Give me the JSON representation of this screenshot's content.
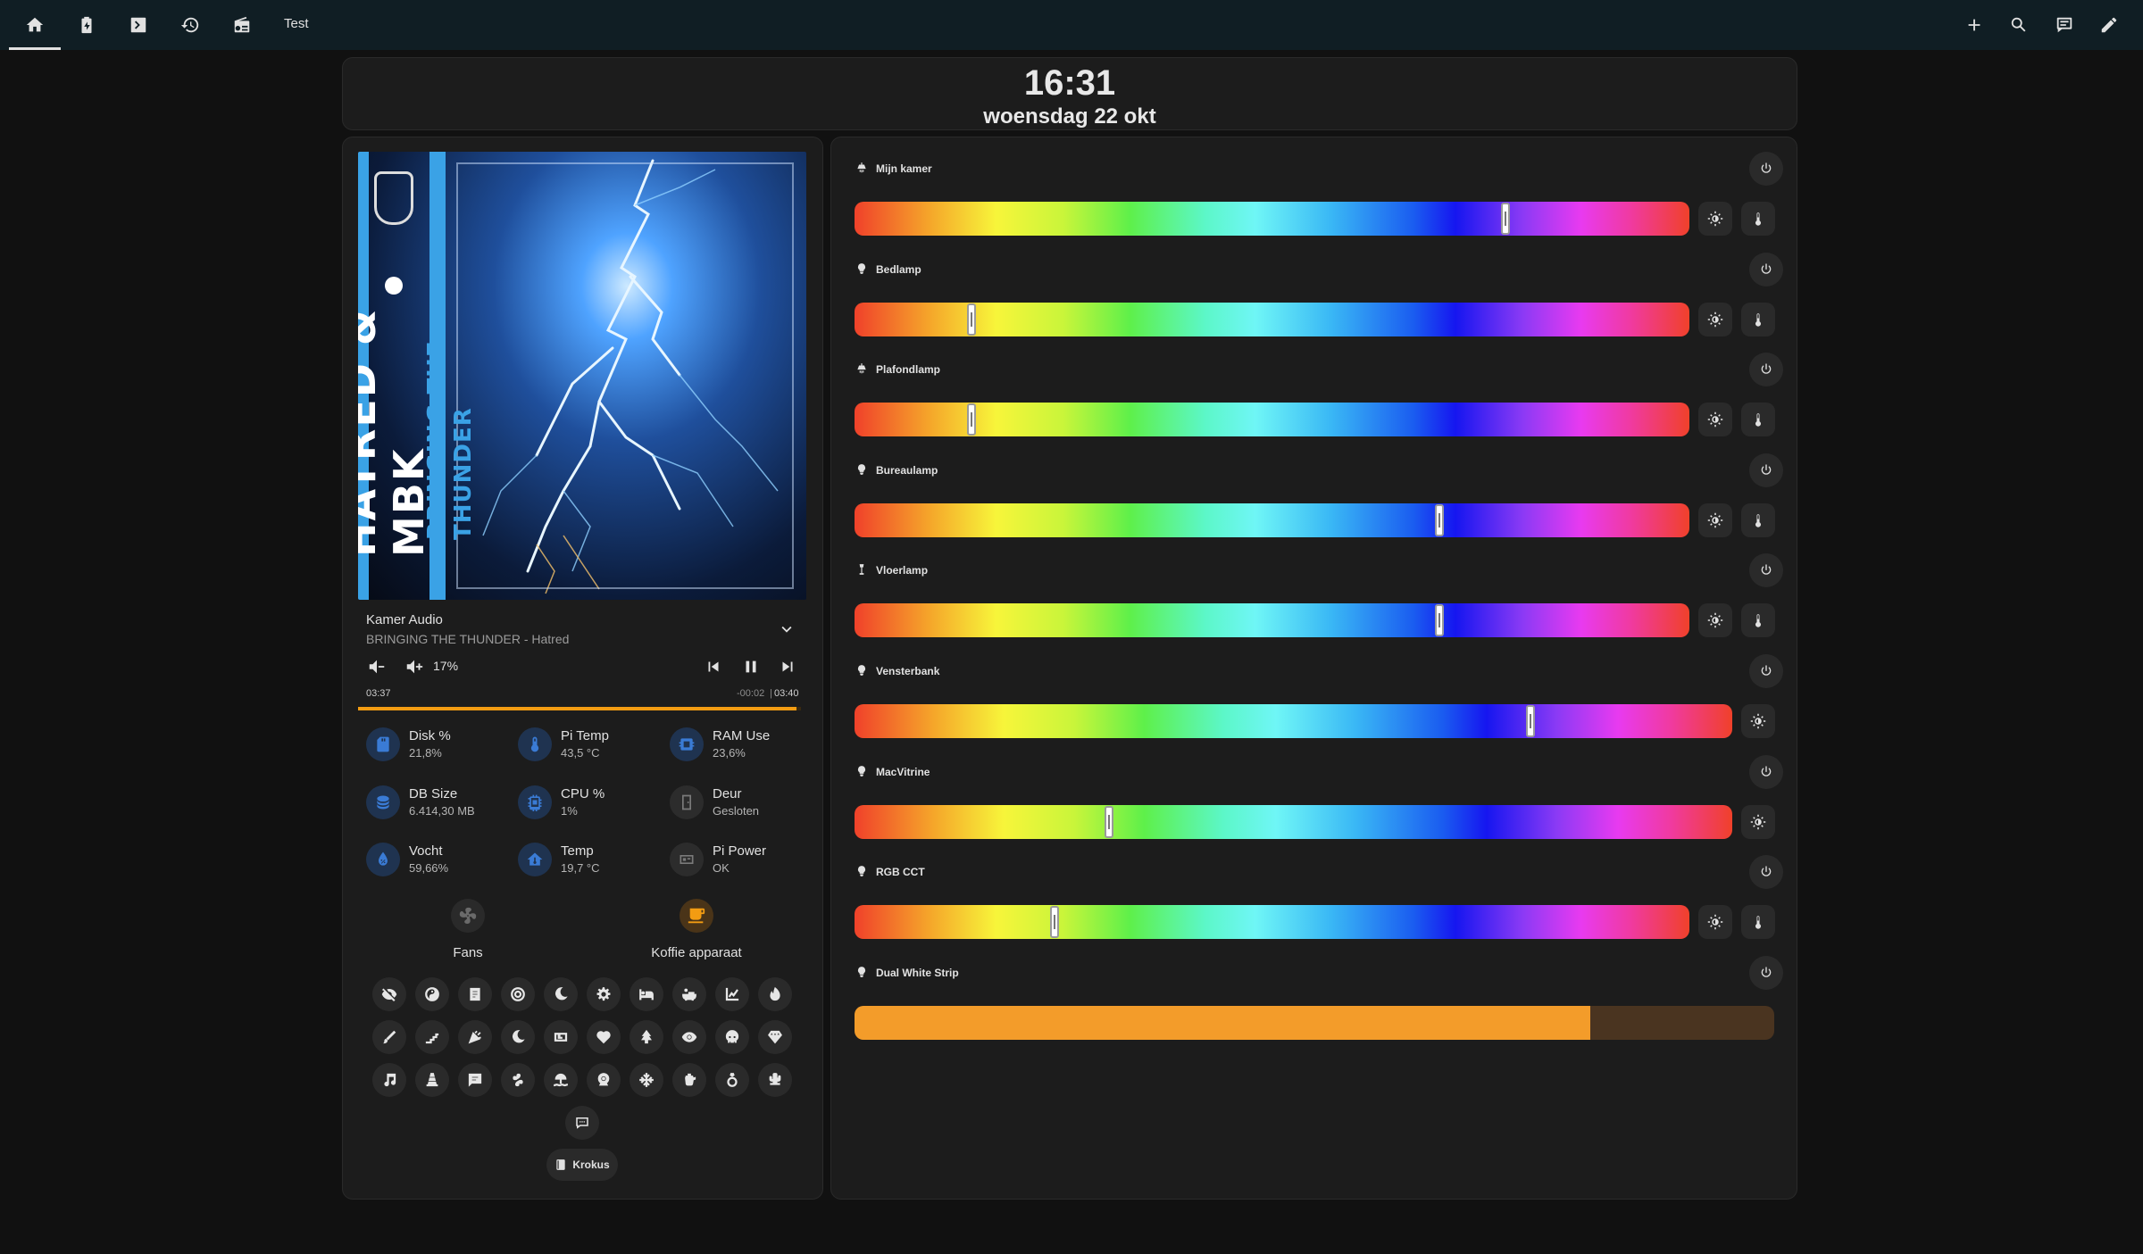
{
  "topbar": {
    "tabs": [
      {
        "icon": "home-icon"
      },
      {
        "icon": "battery-icon"
      },
      {
        "icon": "terminal-icon"
      },
      {
        "icon": "history-icon"
      },
      {
        "icon": "radio-icon"
      }
    ],
    "title": "Test",
    "actions": [
      "plus-icon",
      "search-icon",
      "chat-icon",
      "pencil-icon"
    ]
  },
  "clock": {
    "time": "16:31",
    "date": "woensdag 22 okt"
  },
  "media": {
    "album_artist_text": "HATRED & MBK",
    "album_title_text": "BRINGING THE THUNDER",
    "player": "Kamer Audio",
    "track": "BRINGING THE THUNDER - Hatred",
    "volume": "17%",
    "elapsed": "03:37",
    "remaining": "-00:02",
    "separator": "|",
    "duration": "03:40",
    "progress": 0.99
  },
  "sensors": [
    {
      "name": "Disk %",
      "value": "21,8%",
      "icon": "sd-card-icon",
      "color": "#3a7bd5"
    },
    {
      "name": "Pi Temp",
      "value": "43,5 °C",
      "icon": "thermometer-icon",
      "color": "#3a7bd5"
    },
    {
      "name": "RAM Use",
      "value": "23,6%",
      "icon": "chip-icon",
      "color": "#3a7bd5"
    },
    {
      "name": "DB Size",
      "value": "6.414,30 MB",
      "icon": "database-icon",
      "color": "#3a7bd5"
    },
    {
      "name": "CPU %",
      "value": "1%",
      "icon": "cpu-icon",
      "color": "#3a7bd5"
    },
    {
      "name": "Deur",
      "value": "Gesloten",
      "icon": "door-icon",
      "color": "#7a7a7a"
    },
    {
      "name": "Vocht",
      "value": "59,66%",
      "icon": "water-percent-icon",
      "color": "#3a7bd5"
    },
    {
      "name": "Temp",
      "value": "19,7 °C",
      "icon": "home-thermometer-icon",
      "color": "#3a7bd5"
    },
    {
      "name": "Pi Power",
      "value": "OK",
      "icon": "power-plug-icon",
      "color": "#7a7a7a"
    }
  ],
  "buttons": [
    {
      "label": "Fans",
      "icon": "fan-icon",
      "color": "#6a6a6a"
    },
    {
      "label": "Koffie apparaat",
      "icon": "coffee-icon",
      "color": "#f39c12"
    }
  ],
  "scenes": {
    "row1": [
      "eye-off-icon",
      "yin-yang-icon",
      "notebook-icon",
      "target-icon",
      "moon-icon",
      "cog-icon",
      "bed-icon",
      "bathtub-icon",
      "chart-icon",
      "fire-icon"
    ],
    "row2": [
      "pencil-brush-icon",
      "stairs-icon",
      "party-icon",
      "moon-icon",
      "tv-icon",
      "heart-icon",
      "tree-icon",
      "eye-icon",
      "skull-icon",
      "diamond-icon"
    ],
    "row3": [
      "music-icon",
      "traffic-cone-icon",
      "message-icon",
      "clover-icon",
      "beach-icon",
      "webcam-icon",
      "snowflake-icon",
      "kettle-icon",
      "ring-icon",
      "cactus-icon"
    ],
    "extra": "chat-bubble-icon",
    "krokus": "Krokus"
  },
  "lights": [
    {
      "name": "Mijn kamer",
      "icon": "ceiling-light-icon",
      "hue_position": 0.78,
      "controls": "brightness-temp"
    },
    {
      "name": "Bedlamp",
      "icon": "bulb-icon",
      "hue_position": 0.14,
      "controls": "brightness-temp"
    },
    {
      "name": "Plafondlamp",
      "icon": "ceiling-light-icon",
      "hue_position": 0.14,
      "controls": "brightness-temp"
    },
    {
      "name": "Bureaulamp",
      "icon": "bulb-icon",
      "hue_position": 0.7,
      "controls": "brightness-temp"
    },
    {
      "name": "Vloerlamp",
      "icon": "floor-lamp-icon",
      "hue_position": 0.7,
      "controls": "brightness-temp"
    },
    {
      "name": "Vensterbank",
      "icon": "bulb-icon",
      "hue_position": 0.77,
      "controls": "brightness"
    },
    {
      "name": "MacVitrine",
      "icon": "bulb-icon",
      "hue_position": 0.29,
      "controls": "brightness"
    },
    {
      "name": "RGB CCT",
      "icon": "bulb-icon",
      "hue_position": 0.24,
      "controls": "brightness-temp"
    },
    {
      "name": "Dual White Strip",
      "icon": "bulb-icon",
      "brightness": 0.8,
      "controls": "none"
    }
  ],
  "colors": {
    "accent": "#f39c12",
    "background": "#111111",
    "card": "#1c1c1c",
    "topbar": "#101e24"
  }
}
